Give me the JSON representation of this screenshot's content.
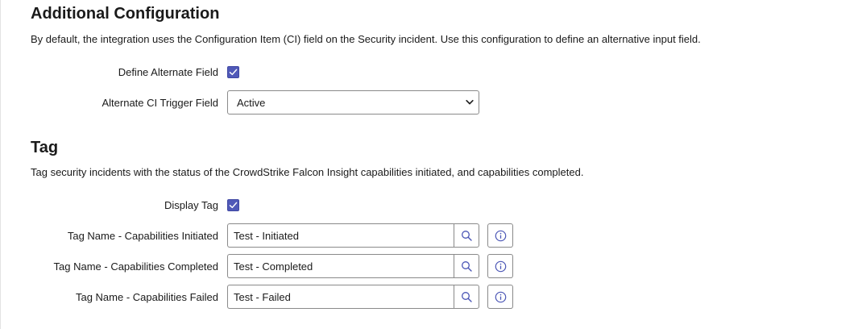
{
  "additional_configuration": {
    "title": "Additional Configuration",
    "description": "By default, the integration uses the Configuration Item (CI) field on the Security incident. Use this configuration to define an alternative input field.",
    "define_alternate_field": {
      "label": "Define Alternate Field",
      "checked": true
    },
    "alternate_ci_trigger_field": {
      "label": "Alternate CI Trigger Field",
      "selected": "Active"
    }
  },
  "tag": {
    "title": "Tag",
    "description": "Tag security incidents with the status of the CrowdStrike Falcon Insight capabilities initiated, and capabilities completed.",
    "display_tag": {
      "label": "Display Tag",
      "checked": true
    },
    "fields": [
      {
        "label": "Tag Name - Capabilities Initiated",
        "value": "Test - Initiated"
      },
      {
        "label": "Tag Name - Capabilities Completed",
        "value": "Test - Completed"
      },
      {
        "label": "Tag Name - Capabilities Failed",
        "value": "Test - Failed"
      }
    ]
  },
  "icons": {
    "checkbox": "check-icon",
    "select": "chevron-down-icon",
    "lookup": "search-icon",
    "info": "info-icon"
  },
  "colors": {
    "checkbox_fill": "#5059b8",
    "info_icon": "#4a55b5",
    "border": "#8a8a8a"
  }
}
